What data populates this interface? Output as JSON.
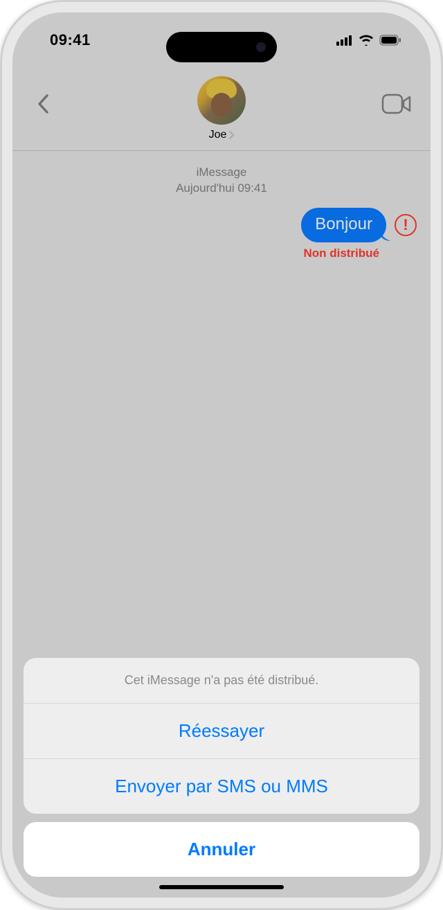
{
  "statusBar": {
    "time": "09:41"
  },
  "header": {
    "contactName": "Joe"
  },
  "thread": {
    "serviceLine": "iMessage",
    "timestampLine": "Aujourd'hui 09:41",
    "message": "Bonjour",
    "deliveryStatus": "Non distribué"
  },
  "actionSheet": {
    "title": "Cet iMessage n'a pas été distribué.",
    "retry": "Réessayer",
    "sendAsSms": "Envoyer par SMS ou MMS",
    "cancel": "Annuler"
  }
}
